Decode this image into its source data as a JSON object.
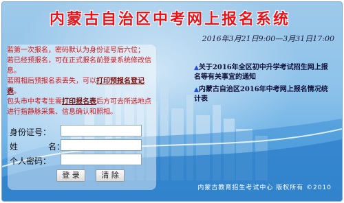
{
  "title": "内蒙古自治区中考网上报名系统",
  "date_range": "2016年3月21日9:00—3月31日17:00",
  "notice": {
    "line1": "若第一次报名，密码默认为身份证号后六位；",
    "line2": "若已经预报名，可在正式报名前登录系统修改信息。",
    "line3_prefix": "若照相后预报名表丢失，可以",
    "line3_link": "打印预报名登记表",
    "line3_suffix": "。",
    "line4_prefix": "包头市中考考生需",
    "line4_link": "打印报名表",
    "line4_suffix": "后方可去所选地点进行指静脉采集、信息确认和照相。"
  },
  "form": {
    "id_label": "身份证号：",
    "name_label1": "姓",
    "name_label2": "名：",
    "password_label": "个人密码：",
    "id_value": "",
    "name_value": "",
    "password_value": ""
  },
  "buttons": {
    "login": "登 录",
    "clear": "清 除"
  },
  "news": [
    "关于2016年全区初中升学考试招生网上报名等有关事宜的通知",
    "内蒙古自治区2016年中考网上报名情况统计表"
  ],
  "footer": "内蒙古教育招生考试中心  版权所有 ©2010",
  "colors": {
    "title": "#e8141b",
    "notice": "#d0161b",
    "bullet": "#1f4fd6"
  }
}
